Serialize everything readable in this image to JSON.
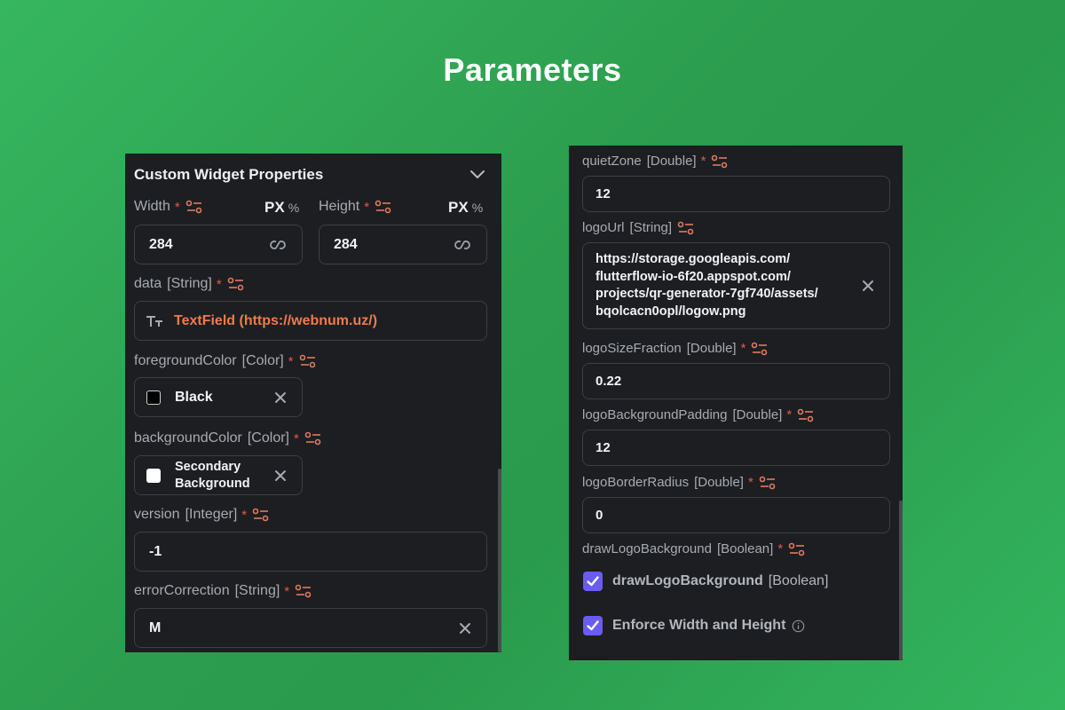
{
  "page": {
    "title": "Parameters"
  },
  "left_panel": {
    "section_title": "Custom Widget Properties",
    "width": {
      "label": "Width",
      "required": "*",
      "unit_px": "PX",
      "unit_pct": "%",
      "value": "284"
    },
    "height": {
      "label": "Height",
      "required": "*",
      "unit_px": "PX",
      "unit_pct": "%",
      "value": "284"
    },
    "data": {
      "label": "data",
      "type": "[String]",
      "required": "*",
      "value": "TextField (https://webnum.uz/)",
      "value_color": "#f07a4a"
    },
    "foregroundColor": {
      "label": "foregroundColor",
      "type": "[Color]",
      "required": "*",
      "value": "Black",
      "swatch": "#000000"
    },
    "backgroundColor": {
      "label": "backgroundColor",
      "type": "[Color]",
      "required": "*",
      "value_line1": "Secondary",
      "value_line2": "Background",
      "swatch": "#ffffff"
    },
    "version": {
      "label": "version",
      "type": "[Integer]",
      "required": "*",
      "value": "-1"
    },
    "errorCorrection": {
      "label": "errorCorrection",
      "type": "[String]",
      "required": "*",
      "value": "M"
    }
  },
  "right_panel": {
    "quietZone": {
      "label": "quietZone",
      "type": "[Double]",
      "required": "*",
      "value": "12"
    },
    "logoUrl": {
      "label": "logoUrl",
      "type": "[String]",
      "value_lines": [
        "https://storage.googleapis.com/",
        "flutterflow-io-6f20.appspot.com/",
        "projects/qr-generator-7gf740/assets/",
        "bqolcacn0opl/logow.png"
      ]
    },
    "logoSizeFraction": {
      "label": "logoSizeFraction",
      "type": "[Double]",
      "required": "*",
      "value": "0.22"
    },
    "logoBackgroundPadding": {
      "label": "logoBackgroundPadding",
      "type": "[Double]",
      "required": "*",
      "value": "12"
    },
    "logoBorderRadius": {
      "label": "logoBorderRadius",
      "type": "[Double]",
      "required": "*",
      "value": "0"
    },
    "drawLogoBackground": {
      "label": "drawLogoBackground",
      "type": "[Boolean]",
      "required": "*",
      "checkbox_label": "drawLogoBackground",
      "checkbox_type": "[Boolean]",
      "checked": true
    },
    "enforce": {
      "label": "Enforce Width and Height",
      "checked": true
    }
  },
  "colors": {
    "panel_bg": "#1c1e21",
    "accent_checkbox": "#6a5cf3",
    "required_star": "#e3574d",
    "tune_icon": "#e07a5f",
    "text_field_orange": "#f07a4a"
  },
  "icons": [
    "chevron-down-icon",
    "tune-icon",
    "link-icon",
    "close-icon",
    "text-type-icon",
    "checkbox-checked-icon",
    "info-icon"
  ]
}
